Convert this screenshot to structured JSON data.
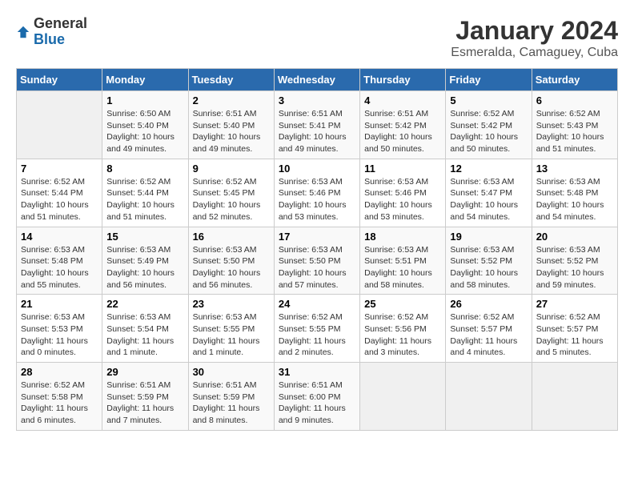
{
  "header": {
    "logo_general": "General",
    "logo_blue": "Blue",
    "month": "January 2024",
    "location": "Esmeralda, Camaguey, Cuba"
  },
  "weekdays": [
    "Sunday",
    "Monday",
    "Tuesday",
    "Wednesday",
    "Thursday",
    "Friday",
    "Saturday"
  ],
  "weeks": [
    [
      {
        "day": "",
        "sunrise": "",
        "sunset": "",
        "daylight": ""
      },
      {
        "day": "1",
        "sunrise": "Sunrise: 6:50 AM",
        "sunset": "Sunset: 5:40 PM",
        "daylight": "Daylight: 10 hours and 49 minutes."
      },
      {
        "day": "2",
        "sunrise": "Sunrise: 6:51 AM",
        "sunset": "Sunset: 5:40 PM",
        "daylight": "Daylight: 10 hours and 49 minutes."
      },
      {
        "day": "3",
        "sunrise": "Sunrise: 6:51 AM",
        "sunset": "Sunset: 5:41 PM",
        "daylight": "Daylight: 10 hours and 49 minutes."
      },
      {
        "day": "4",
        "sunrise": "Sunrise: 6:51 AM",
        "sunset": "Sunset: 5:42 PM",
        "daylight": "Daylight: 10 hours and 50 minutes."
      },
      {
        "day": "5",
        "sunrise": "Sunrise: 6:52 AM",
        "sunset": "Sunset: 5:42 PM",
        "daylight": "Daylight: 10 hours and 50 minutes."
      },
      {
        "day": "6",
        "sunrise": "Sunrise: 6:52 AM",
        "sunset": "Sunset: 5:43 PM",
        "daylight": "Daylight: 10 hours and 51 minutes."
      }
    ],
    [
      {
        "day": "7",
        "sunrise": "Sunrise: 6:52 AM",
        "sunset": "Sunset: 5:44 PM",
        "daylight": "Daylight: 10 hours and 51 minutes."
      },
      {
        "day": "8",
        "sunrise": "Sunrise: 6:52 AM",
        "sunset": "Sunset: 5:44 PM",
        "daylight": "Daylight: 10 hours and 51 minutes."
      },
      {
        "day": "9",
        "sunrise": "Sunrise: 6:52 AM",
        "sunset": "Sunset: 5:45 PM",
        "daylight": "Daylight: 10 hours and 52 minutes."
      },
      {
        "day": "10",
        "sunrise": "Sunrise: 6:53 AM",
        "sunset": "Sunset: 5:46 PM",
        "daylight": "Daylight: 10 hours and 53 minutes."
      },
      {
        "day": "11",
        "sunrise": "Sunrise: 6:53 AM",
        "sunset": "Sunset: 5:46 PM",
        "daylight": "Daylight: 10 hours and 53 minutes."
      },
      {
        "day": "12",
        "sunrise": "Sunrise: 6:53 AM",
        "sunset": "Sunset: 5:47 PM",
        "daylight": "Daylight: 10 hours and 54 minutes."
      },
      {
        "day": "13",
        "sunrise": "Sunrise: 6:53 AM",
        "sunset": "Sunset: 5:48 PM",
        "daylight": "Daylight: 10 hours and 54 minutes."
      }
    ],
    [
      {
        "day": "14",
        "sunrise": "Sunrise: 6:53 AM",
        "sunset": "Sunset: 5:48 PM",
        "daylight": "Daylight: 10 hours and 55 minutes."
      },
      {
        "day": "15",
        "sunrise": "Sunrise: 6:53 AM",
        "sunset": "Sunset: 5:49 PM",
        "daylight": "Daylight: 10 hours and 56 minutes."
      },
      {
        "day": "16",
        "sunrise": "Sunrise: 6:53 AM",
        "sunset": "Sunset: 5:50 PM",
        "daylight": "Daylight: 10 hours and 56 minutes."
      },
      {
        "day": "17",
        "sunrise": "Sunrise: 6:53 AM",
        "sunset": "Sunset: 5:50 PM",
        "daylight": "Daylight: 10 hours and 57 minutes."
      },
      {
        "day": "18",
        "sunrise": "Sunrise: 6:53 AM",
        "sunset": "Sunset: 5:51 PM",
        "daylight": "Daylight: 10 hours and 58 minutes."
      },
      {
        "day": "19",
        "sunrise": "Sunrise: 6:53 AM",
        "sunset": "Sunset: 5:52 PM",
        "daylight": "Daylight: 10 hours and 58 minutes."
      },
      {
        "day": "20",
        "sunrise": "Sunrise: 6:53 AM",
        "sunset": "Sunset: 5:52 PM",
        "daylight": "Daylight: 10 hours and 59 minutes."
      }
    ],
    [
      {
        "day": "21",
        "sunrise": "Sunrise: 6:53 AM",
        "sunset": "Sunset: 5:53 PM",
        "daylight": "Daylight: 11 hours and 0 minutes."
      },
      {
        "day": "22",
        "sunrise": "Sunrise: 6:53 AM",
        "sunset": "Sunset: 5:54 PM",
        "daylight": "Daylight: 11 hours and 1 minute."
      },
      {
        "day": "23",
        "sunrise": "Sunrise: 6:53 AM",
        "sunset": "Sunset: 5:55 PM",
        "daylight": "Daylight: 11 hours and 1 minute."
      },
      {
        "day": "24",
        "sunrise": "Sunrise: 6:52 AM",
        "sunset": "Sunset: 5:55 PM",
        "daylight": "Daylight: 11 hours and 2 minutes."
      },
      {
        "day": "25",
        "sunrise": "Sunrise: 6:52 AM",
        "sunset": "Sunset: 5:56 PM",
        "daylight": "Daylight: 11 hours and 3 minutes."
      },
      {
        "day": "26",
        "sunrise": "Sunrise: 6:52 AM",
        "sunset": "Sunset: 5:57 PM",
        "daylight": "Daylight: 11 hours and 4 minutes."
      },
      {
        "day": "27",
        "sunrise": "Sunrise: 6:52 AM",
        "sunset": "Sunset: 5:57 PM",
        "daylight": "Daylight: 11 hours and 5 minutes."
      }
    ],
    [
      {
        "day": "28",
        "sunrise": "Sunrise: 6:52 AM",
        "sunset": "Sunset: 5:58 PM",
        "daylight": "Daylight: 11 hours and 6 minutes."
      },
      {
        "day": "29",
        "sunrise": "Sunrise: 6:51 AM",
        "sunset": "Sunset: 5:59 PM",
        "daylight": "Daylight: 11 hours and 7 minutes."
      },
      {
        "day": "30",
        "sunrise": "Sunrise: 6:51 AM",
        "sunset": "Sunset: 5:59 PM",
        "daylight": "Daylight: 11 hours and 8 minutes."
      },
      {
        "day": "31",
        "sunrise": "Sunrise: 6:51 AM",
        "sunset": "Sunset: 6:00 PM",
        "daylight": "Daylight: 11 hours and 9 minutes."
      },
      {
        "day": "",
        "sunrise": "",
        "sunset": "",
        "daylight": ""
      },
      {
        "day": "",
        "sunrise": "",
        "sunset": "",
        "daylight": ""
      },
      {
        "day": "",
        "sunrise": "",
        "sunset": "",
        "daylight": ""
      }
    ]
  ]
}
